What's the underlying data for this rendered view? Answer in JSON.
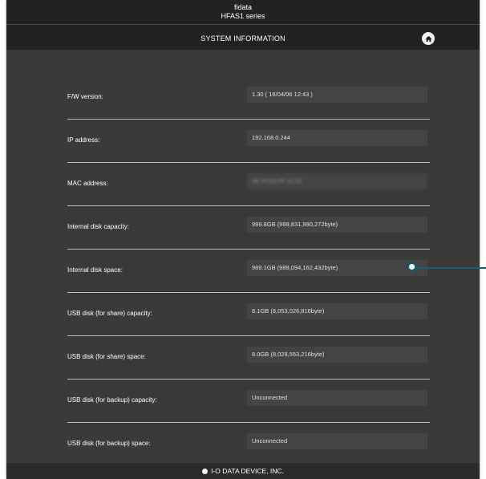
{
  "header": {
    "brand_line1": "fidata",
    "brand_line2": "HFAS1 series",
    "page_title": "SYSTEM INFORMATION",
    "home_icon": "home-icon"
  },
  "rows": [
    {
      "label": "F/W version:",
      "value": "1.30 ( 16/04/06 12:43 )"
    },
    {
      "label": "IP address:",
      "value": "192.168.0.244"
    },
    {
      "label": "MAC address:",
      "value": "34:76:C5:FF:11:22"
    },
    {
      "label": "Internal disk capacity:",
      "value": "999.8GB (999,831,990,272byte)"
    },
    {
      "label": "Internal disk space:",
      "value": "989.1GB (989,094,162,432byte)"
    },
    {
      "label": "USB disk (for share) capacity:",
      "value": "8.1GB (8,053,026,816byte)"
    },
    {
      "label": "USB disk (for share) space:",
      "value": "8.0GB (8,028,553,216byte)"
    },
    {
      "label": "USB disk (for backup) capacity:",
      "value": "Unconnected"
    },
    {
      "label": "USB disk (for backup) space:",
      "value": "Unconnected"
    }
  ],
  "footer": {
    "text": "I-O DATA DEVICE, INC."
  },
  "colors": {
    "background": "#3a3a3a",
    "header": "#222222",
    "callout": "#0e5f78"
  }
}
